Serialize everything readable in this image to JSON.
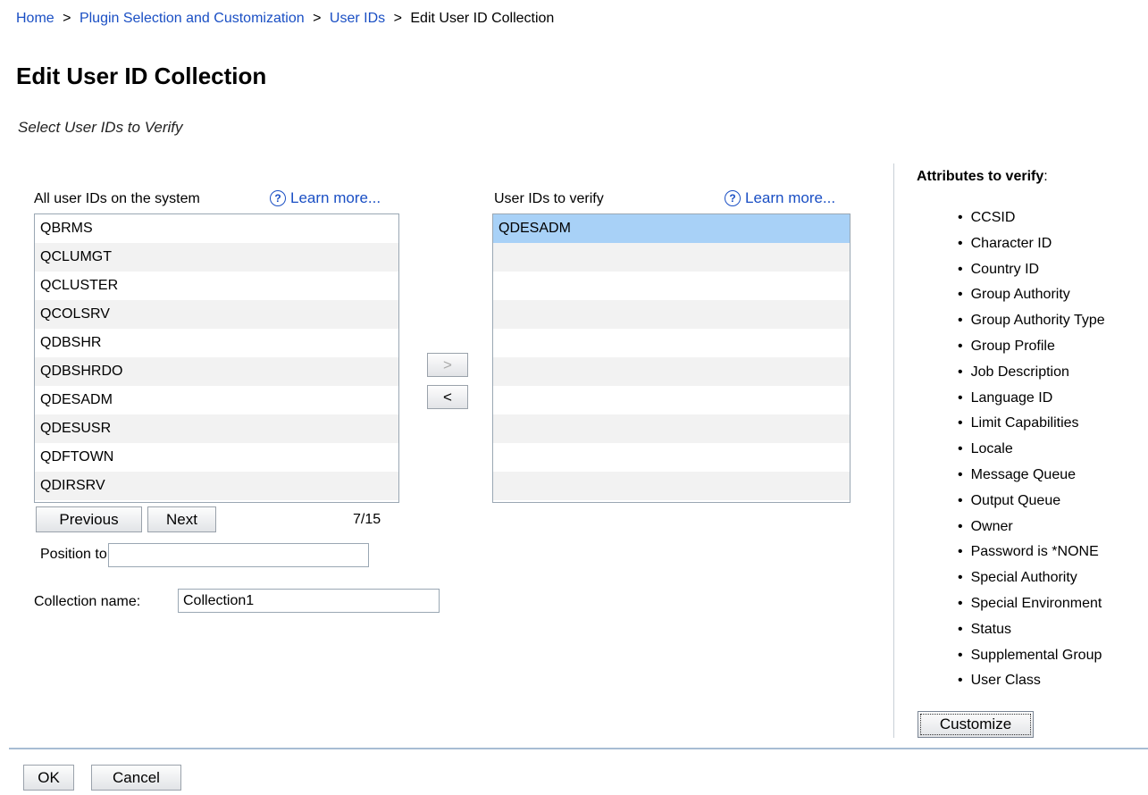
{
  "breadcrumb": [
    {
      "label": "Home",
      "link": true
    },
    {
      "label": "Plugin Selection and Customization",
      "link": true
    },
    {
      "label": "User IDs",
      "link": true
    },
    {
      "label": "Edit User ID Collection",
      "link": false
    }
  ],
  "separator": ">",
  "page_title": "Edit User ID Collection",
  "subtitle": "Select User IDs to Verify",
  "left_list": {
    "header": "All user IDs on the system",
    "learn_more": "Learn more...",
    "items": [
      "QBRMS",
      "QCLUMGT",
      "QCLUSTER",
      "QCOLSRV",
      "QDBSHR",
      "QDBSHRDO",
      "QDESADM",
      "QDESUSR",
      "QDFTOWN",
      "QDIRSRV"
    ]
  },
  "right_list": {
    "header": "User IDs to verify",
    "learn_more": "Learn more...",
    "items": [
      "QDESADM",
      "",
      "",
      "",
      "",
      "",
      "",
      "",
      "",
      ""
    ],
    "selected_index": 0
  },
  "move_buttons": {
    "add": ">",
    "remove": "<"
  },
  "paging": {
    "previous": "Previous",
    "next": "Next",
    "page": "7/15"
  },
  "position_to": {
    "label": "Position to:",
    "value": ""
  },
  "collection": {
    "label": "Collection name:",
    "value": "Collection1"
  },
  "attributes": {
    "heading": "Attributes to verify",
    "heading_suffix": ":",
    "items": [
      "CCSID",
      "Character ID",
      "Country ID",
      "Group Authority",
      "Group Authority Type",
      "Group Profile",
      "Job Description",
      "Language ID",
      "Limit Capabilities",
      "Locale",
      "Message Queue",
      "Output Queue",
      "Owner",
      "Password is *NONE",
      "Special Authority",
      "Special Environment",
      "Status",
      "Supplemental Group",
      "User Class"
    ],
    "customize": "Customize"
  },
  "footer": {
    "ok": "OK",
    "cancel": "Cancel"
  },
  "colors": {
    "link": "#1a4fc4",
    "selected_row": "#a8d1f7",
    "divider": "#a7bdd4"
  },
  "icons": {
    "help": "help-circle-icon"
  }
}
